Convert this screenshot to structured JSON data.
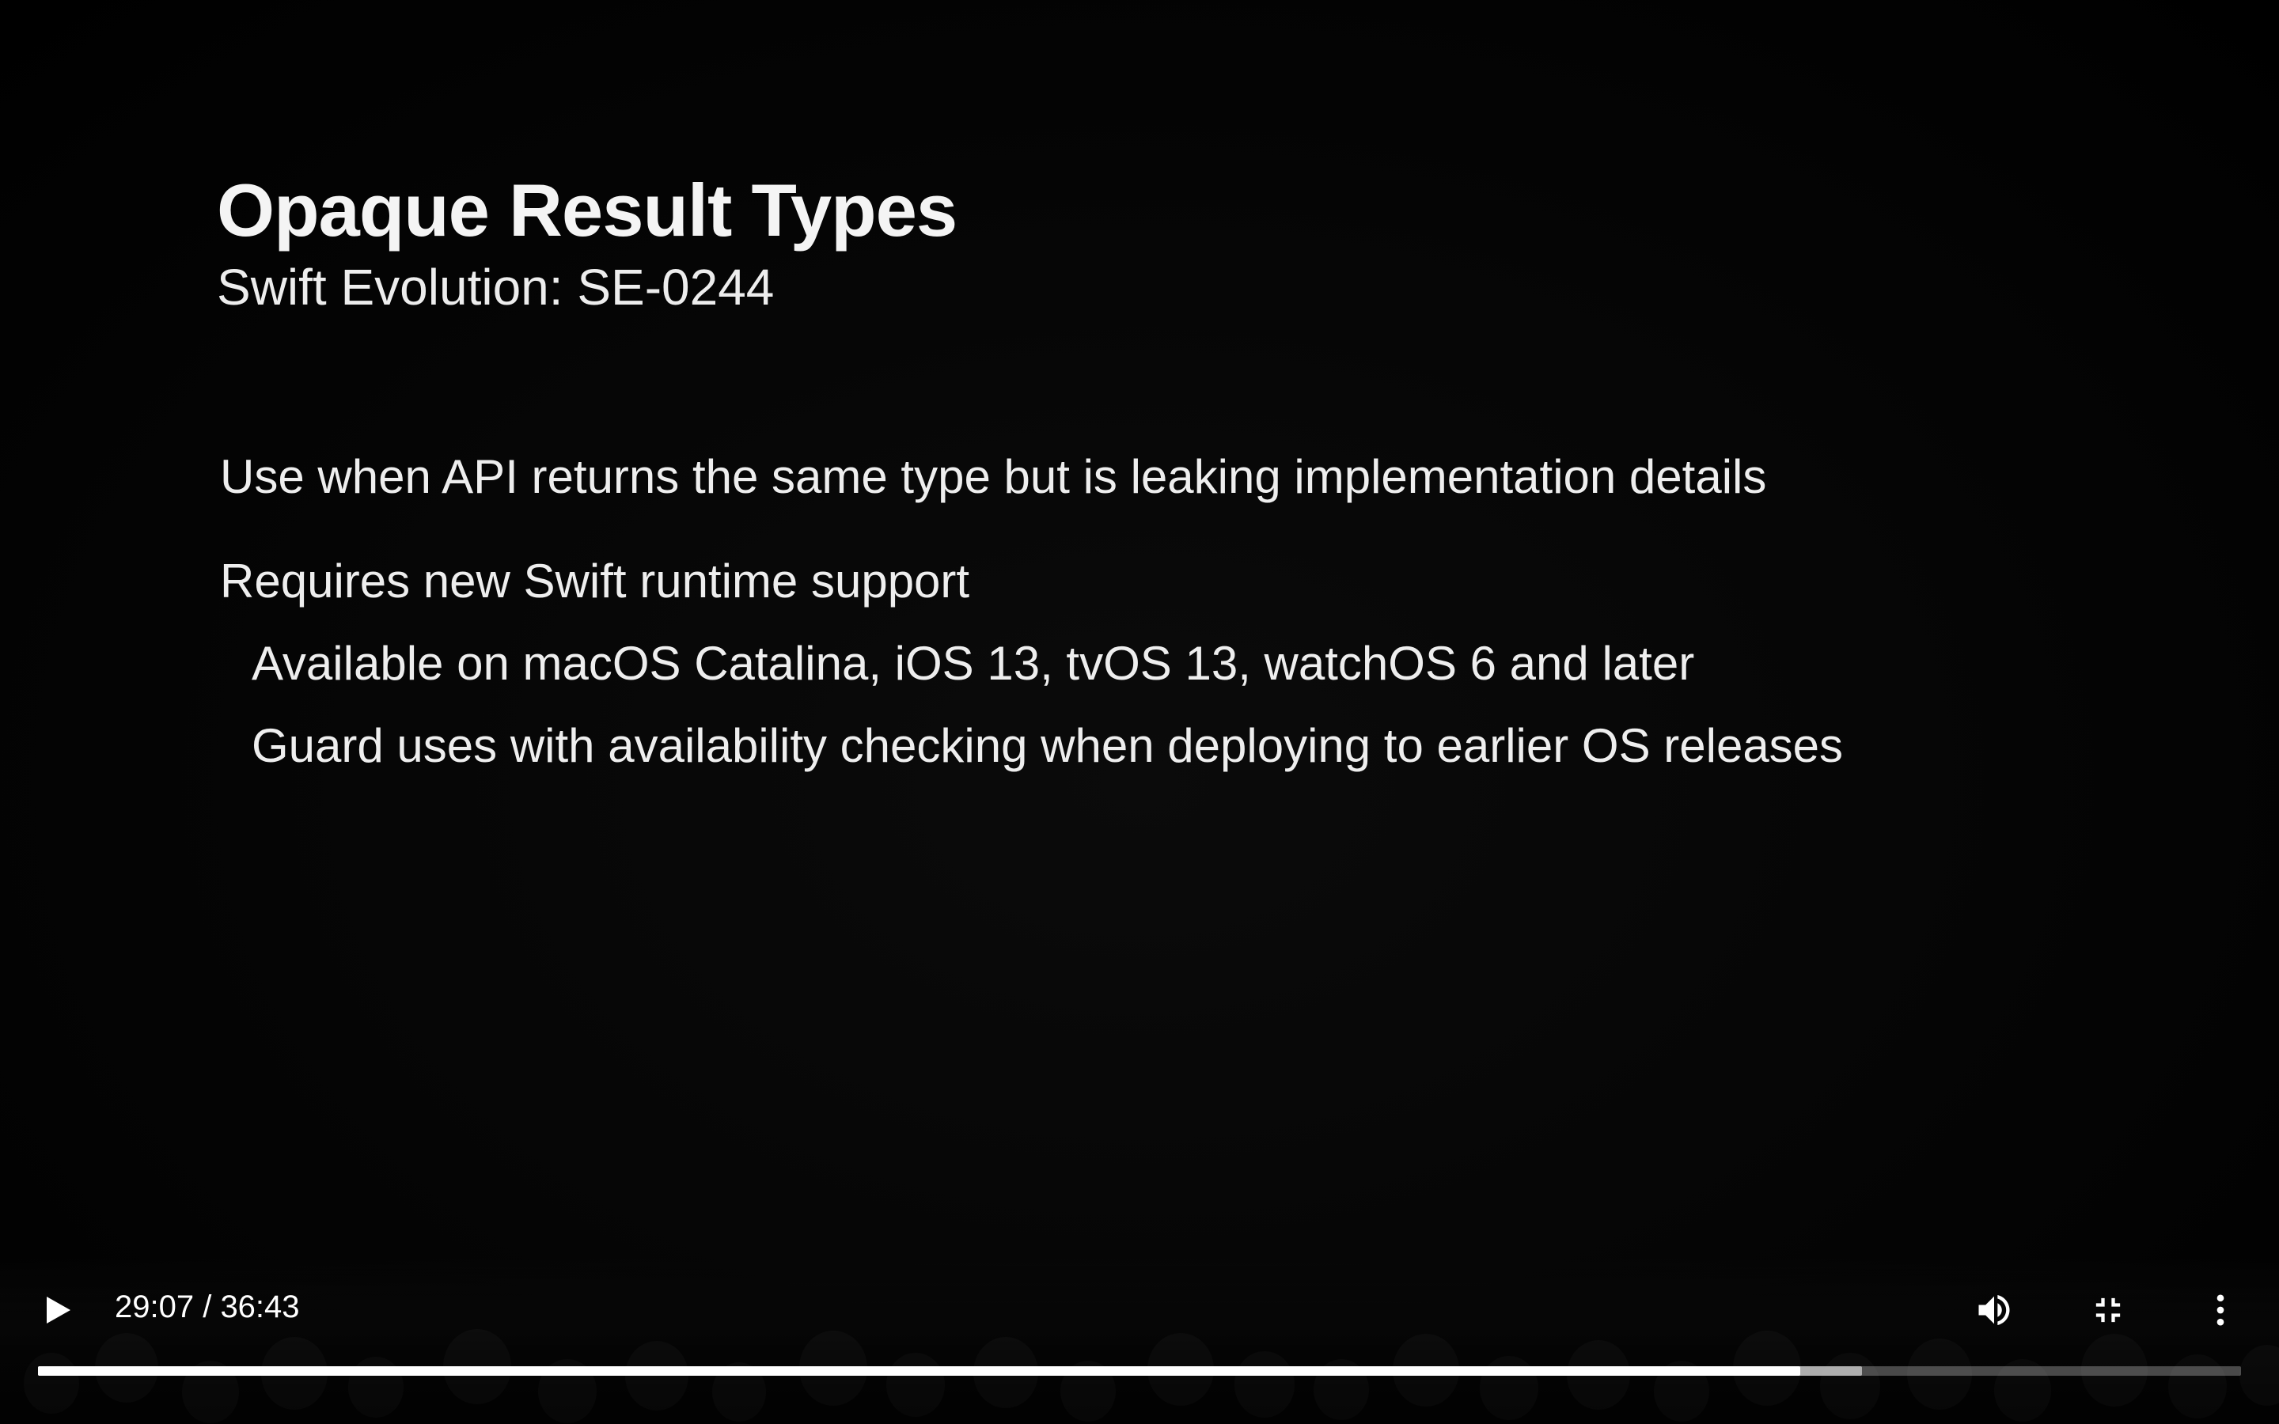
{
  "slide": {
    "title": "Opaque Result Types",
    "subtitle": "Swift Evolution: SE-0244",
    "bullets": [
      "Use when API returns the same type but is leaking implementation details",
      "Requires new Swift runtime support",
      "Available on macOS Catalina, iOS 13, tvOS 13, watchOS 6 and later",
      "Guard uses with availability checking when deploying to earlier OS releases"
    ]
  },
  "player": {
    "time_display": "29:07 / 36:43",
    "played_fraction": 0.8,
    "buffered_fraction": 0.828,
    "icons": {
      "play": "play-icon",
      "volume": "volume-icon",
      "fullscreen": "exit-fullscreen-icon",
      "more": "more-vert-icon"
    },
    "colors": {
      "progress_played": "#ffffff",
      "progress_buffered": "#b0b0b0",
      "progress_track": "#4a4a4a"
    }
  }
}
